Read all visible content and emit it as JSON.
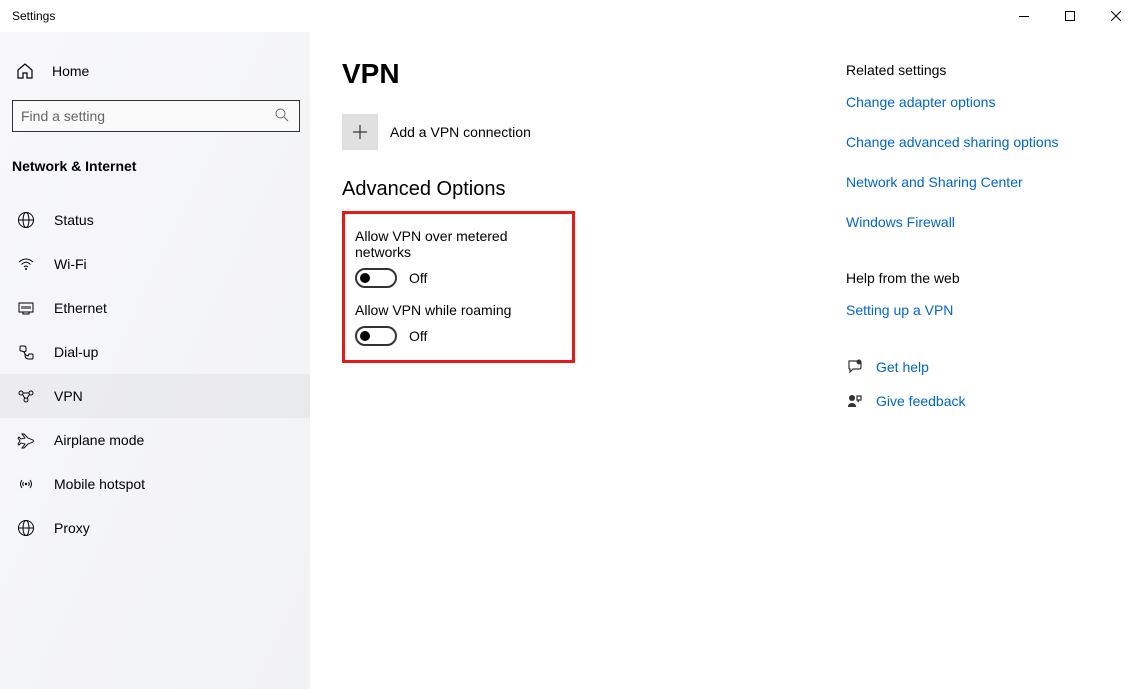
{
  "window": {
    "title": "Settings"
  },
  "sidebar": {
    "home_label": "Home",
    "search_placeholder": "Find a setting",
    "section_header": "Network & Internet",
    "items": [
      {
        "label": "Status"
      },
      {
        "label": "Wi-Fi"
      },
      {
        "label": "Ethernet"
      },
      {
        "label": "Dial-up"
      },
      {
        "label": "VPN"
      },
      {
        "label": "Airplane mode"
      },
      {
        "label": "Mobile hotspot"
      },
      {
        "label": "Proxy"
      }
    ]
  },
  "main": {
    "page_title": "VPN",
    "add_label": "Add a VPN connection",
    "advanced_title": "Advanced Options",
    "toggle1_label": "Allow VPN over metered networks",
    "toggle1_status": "Off",
    "toggle2_label": "Allow VPN while roaming",
    "toggle2_status": "Off"
  },
  "right": {
    "related_title": "Related settings",
    "links": [
      "Change adapter options",
      "Change advanced sharing options",
      "Network and Sharing Center",
      "Windows Firewall"
    ],
    "help_title": "Help from the web",
    "help_link": "Setting up a VPN",
    "get_help": "Get help",
    "give_feedback": "Give feedback"
  }
}
